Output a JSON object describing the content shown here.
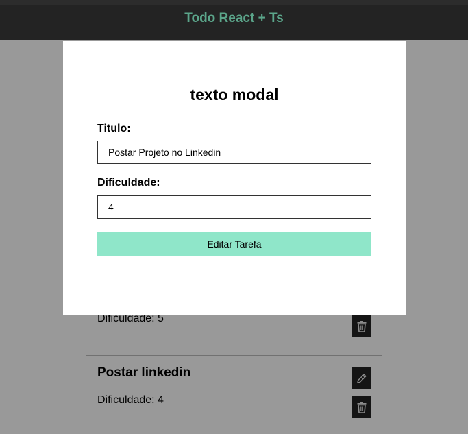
{
  "header": {
    "title": "Todo React + Ts"
  },
  "tasks": [
    {
      "title": "",
      "difficulty_text": "Dificuldade: 5"
    },
    {
      "title": "Postar linkedin",
      "difficulty_text": "Dificuldade: 4"
    }
  ],
  "modal": {
    "title": "texto modal",
    "title_label": "Titulo:",
    "title_value": "Postar Projeto no Linkedin",
    "difficulty_label": "Dificuldade:",
    "difficulty_value": "4",
    "submit_label": "Editar Tarefa"
  },
  "colors": {
    "header_bg": "#232323",
    "header_text": "#5ba58a",
    "button_bg": "#8fe6c9",
    "icon_button_bg": "#232323"
  },
  "icons": {
    "edit": "pencil-icon",
    "delete": "trash-icon"
  }
}
